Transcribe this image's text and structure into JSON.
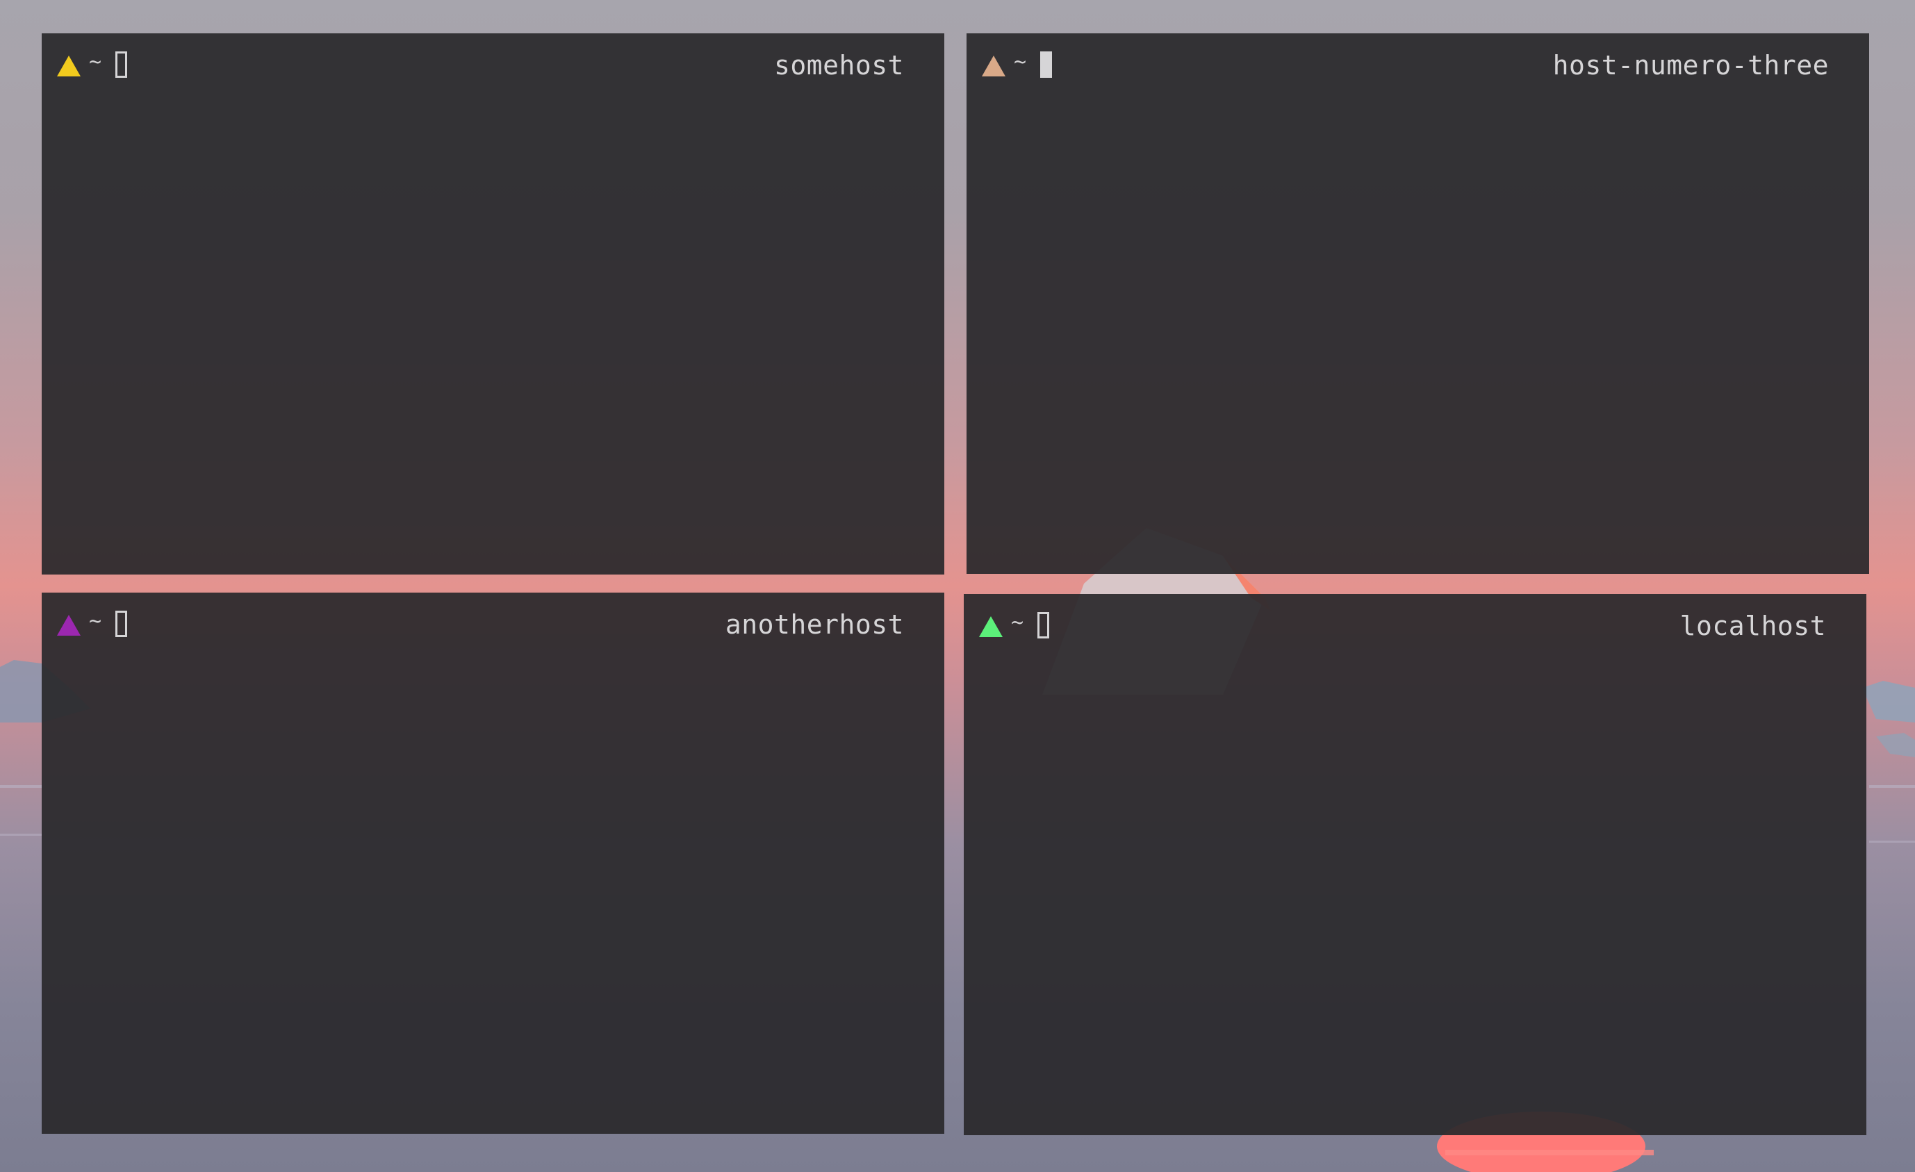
{
  "terminals": [
    {
      "hostname": "somehost",
      "prompt_symbol": "~",
      "prompt_color": "#f2cb1e",
      "cursor": "outline"
    },
    {
      "hostname": "host-numero-three",
      "prompt_symbol": "~",
      "prompt_color": "#d9a988",
      "cursor": "block"
    },
    {
      "hostname": "anotherhost",
      "prompt_symbol": "~",
      "prompt_color": "#9c27b0",
      "cursor": "outline"
    },
    {
      "hostname": "localhost",
      "prompt_symbol": "~",
      "prompt_color": "#5cf07a",
      "cursor": "outline"
    }
  ],
  "colors": {
    "terminal_background": "#2a292c",
    "text": "#d6d5d7",
    "sun": "#ff6f6f"
  }
}
